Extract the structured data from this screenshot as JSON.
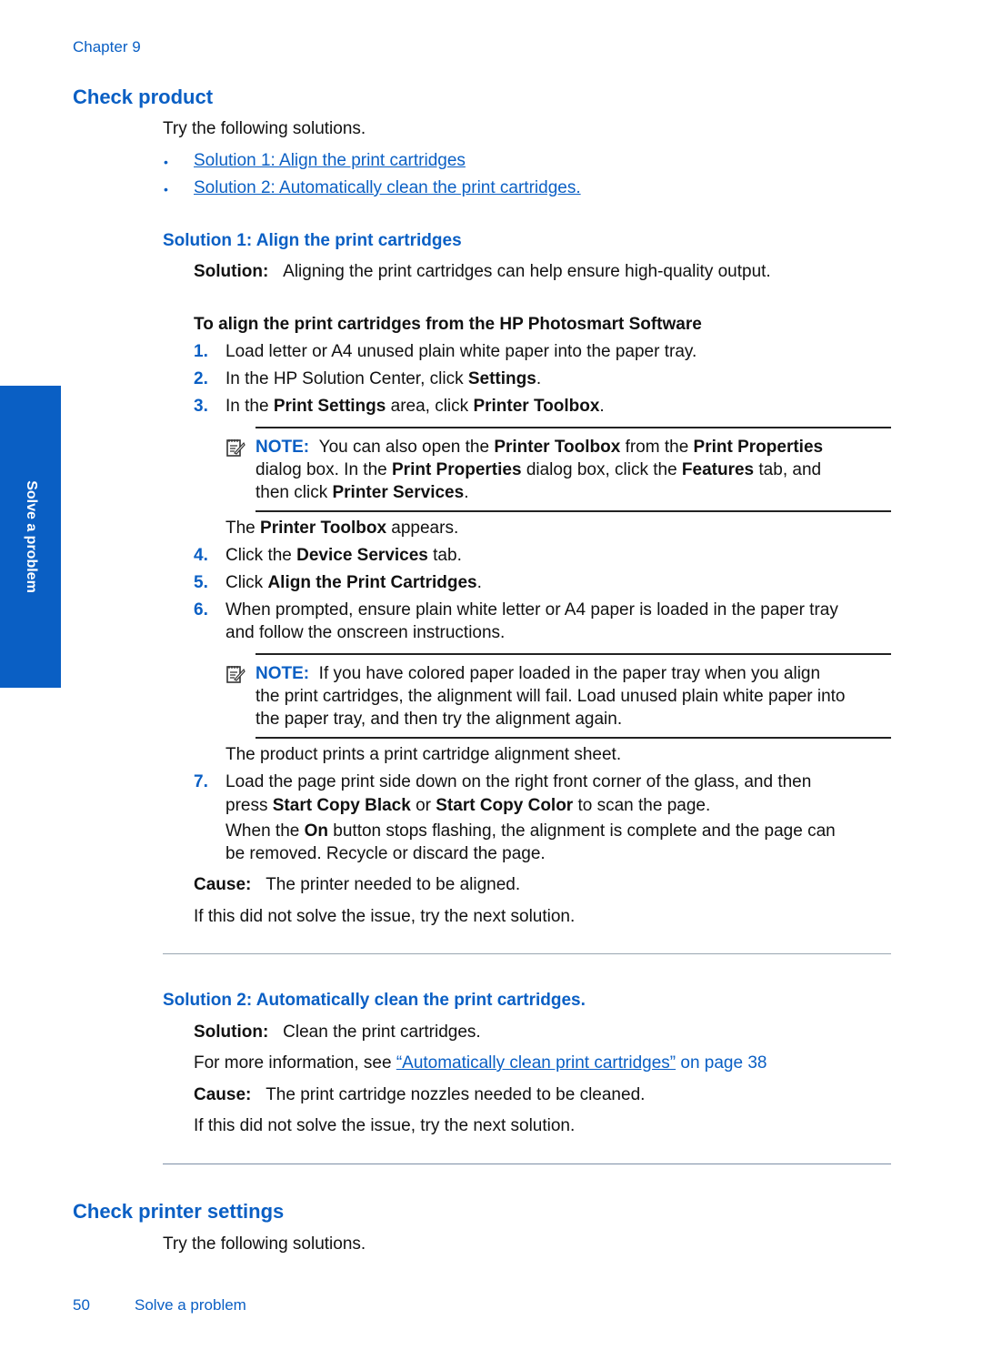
{
  "header": {
    "chapter": "Chapter 9"
  },
  "side_tab": {
    "label": "Solve a problem"
  },
  "check_product": {
    "title": "Check product",
    "intro": "Try the following solutions.",
    "links": [
      "Solution 1: Align the print cartridges",
      "Solution 2: Automatically clean the print cartridges."
    ]
  },
  "solution1": {
    "title": "Solution 1: Align the print cartridges",
    "solution_label": "Solution:",
    "solution_text": "Aligning the print cartridges can help ensure high-quality output.",
    "procedure_title": "To align the print cartridges from the HP Photosmart Software",
    "steps": {
      "s1": {
        "num": "1.",
        "text": "Load letter or A4 unused plain white paper into the paper tray."
      },
      "s2": {
        "num": "2.",
        "a": "In the HP Solution Center, click ",
        "b": "Settings",
        "c": "."
      },
      "s3": {
        "num": "3.",
        "a": "In the ",
        "b": "Print Settings",
        "c": " area, click ",
        "d": "Printer Toolbox",
        "e": "."
      },
      "s4": {
        "num": "4.",
        "a": "Click the ",
        "b": "Device Services",
        "c": " tab."
      },
      "s5": {
        "num": "5.",
        "a": "Click ",
        "b": "Align the Print Cartridges",
        "c": "."
      },
      "s6": {
        "num": "6.",
        "line1": "When prompted, ensure plain white letter or A4 paper is loaded in the paper tray",
        "line2": "and follow the onscreen instructions."
      },
      "s7": {
        "num": "7.",
        "line1": "Load the page print side down on the right front corner of the glass, and then",
        "l2a": "press ",
        "l2b": "Start Copy Black",
        "l2c": " or ",
        "l2d": "Start Copy Color",
        "l2e": " to scan the page.",
        "p1a": "When the ",
        "p1b": "On",
        "p1c": " button stops flashing, the alignment is complete and the page can",
        "p2": "be removed. Recycle or discard the page."
      }
    },
    "note1": {
      "label": "NOTE:",
      "l1a": "You can also open the ",
      "l1b": "Printer Toolbox",
      "l1c": " from the ",
      "l1d": "Print Properties",
      "l2a": "dialog box. In the ",
      "l2b": "Print Properties",
      "l2c": " dialog box, click the ",
      "l2d": "Features",
      "l2e": " tab, and",
      "l3a": "then click ",
      "l3b": "Printer Services",
      "l3c": "."
    },
    "after_note1": {
      "a": "The ",
      "b": "Printer Toolbox",
      "c": " appears."
    },
    "note2": {
      "label": "NOTE:",
      "l1": "If you have colored paper loaded in the paper tray when you align",
      "l2": "the print cartridges, the alignment will fail. Load unused plain white paper into",
      "l3": "the paper tray, and then try the alignment again."
    },
    "after_note2": "The product prints a print cartridge alignment sheet.",
    "cause_label": "Cause:",
    "cause_text": "The printer needed to be aligned.",
    "next": "If this did not solve the issue, try the next solution."
  },
  "solution2": {
    "title": "Solution 2: Automatically clean the print cartridges.",
    "solution_label": "Solution:",
    "solution_text": "Clean the print cartridges.",
    "more_prefix": "For more information, see ",
    "more_link": "“Automatically clean print cartridges”",
    "more_suffix": " on page 38",
    "cause_label": "Cause:",
    "cause_text": "The print cartridge nozzles needed to be cleaned.",
    "next": "If this did not solve the issue, try the next solution."
  },
  "check_printer_settings": {
    "title": "Check printer settings",
    "intro": "Try the following solutions."
  },
  "footer": {
    "page_number": "50",
    "section": "Solve a problem"
  }
}
